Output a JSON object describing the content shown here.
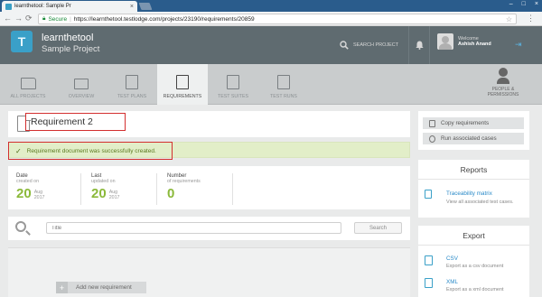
{
  "browser": {
    "tab_title": "learnthetool: Sample Pr",
    "tab_close": "×",
    "window_controls": [
      "–",
      "□",
      "×"
    ],
    "back": "←",
    "forward": "→",
    "reload": "⟳",
    "secure_label": "Secure",
    "url": "https://learnthetool.testlodge.com/projects/23190/requirements/20859",
    "star": "☆",
    "menu": "⋮"
  },
  "header": {
    "logo_letter": "T",
    "brand": "learnthetool",
    "project_name": "Sample Project",
    "search_label": "SEARCH PROJECT",
    "welcome": "Welcome",
    "user_name": "Ashish Anand"
  },
  "nav": {
    "tabs": [
      {
        "label": "ALL PROJECTS"
      },
      {
        "label": "OVERVIEW"
      },
      {
        "label": "TEST PLANS"
      },
      {
        "label": "REQUIREMENTS"
      },
      {
        "label": "TEST SUITES"
      },
      {
        "label": "TEST RUNS"
      }
    ],
    "people_line1": "PEOPLE &",
    "people_line2": "PERMISSIONS"
  },
  "main": {
    "title": "Requirement 2",
    "success_message": "Requirement document was successfully created.",
    "success_check": "✓",
    "stats": [
      {
        "label": "Date",
        "sub": "created on",
        "value": "20",
        "month": "Aug",
        "year": "2017"
      },
      {
        "label": "Last",
        "sub": "updated on",
        "value": "20",
        "month": "Aug",
        "year": "2017"
      },
      {
        "label": "Number",
        "sub": "of requirements",
        "value": "0"
      }
    ],
    "search_placeholder": "Title",
    "search_button": "Search",
    "add_button": "Add new requirement",
    "add_plus": "+"
  },
  "sidebar": {
    "copy_label": "Copy requirements",
    "run_label": "Run associated cases",
    "reports_title": "Reports",
    "trace_link": "Traceability matrix",
    "trace_desc": "View all associated test cases.",
    "export_title": "Export",
    "csv_link": "CSV",
    "csv_desc": "Export as a csv document",
    "xml_link": "XML",
    "xml_desc": "Export as a xml document"
  }
}
